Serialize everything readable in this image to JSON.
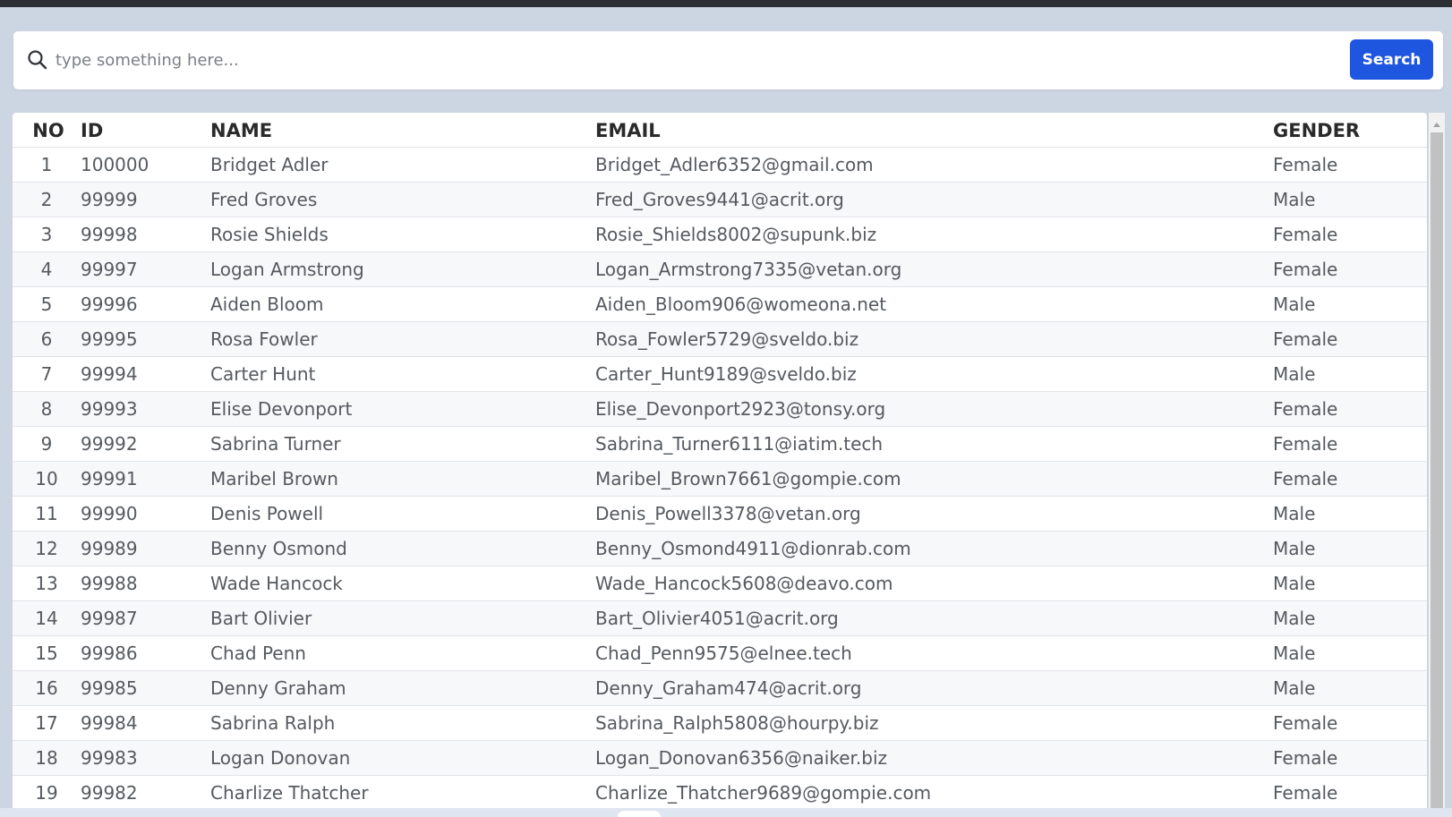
{
  "search": {
    "placeholder": "type something here...",
    "value": "",
    "button_label": "Search",
    "accent_color": "#1f56e0"
  },
  "table": {
    "columns": [
      "NO",
      "ID",
      "NAME",
      "EMAIL",
      "GENDER"
    ],
    "rows": [
      {
        "no": "1",
        "id": "100000",
        "name": "Bridget Adler",
        "email": "Bridget_Adler6352@gmail.com",
        "gender": "Female"
      },
      {
        "no": "2",
        "id": "99999",
        "name": "Fred Groves",
        "email": "Fred_Groves9441@acrit.org",
        "gender": "Male"
      },
      {
        "no": "3",
        "id": "99998",
        "name": "Rosie Shields",
        "email": "Rosie_Shields8002@supunk.biz",
        "gender": "Female"
      },
      {
        "no": "4",
        "id": "99997",
        "name": "Logan Armstrong",
        "email": "Logan_Armstrong7335@vetan.org",
        "gender": "Female"
      },
      {
        "no": "5",
        "id": "99996",
        "name": "Aiden Bloom",
        "email": "Aiden_Bloom906@womeona.net",
        "gender": "Male"
      },
      {
        "no": "6",
        "id": "99995",
        "name": "Rosa Fowler",
        "email": "Rosa_Fowler5729@sveldo.biz",
        "gender": "Female"
      },
      {
        "no": "7",
        "id": "99994",
        "name": "Carter Hunt",
        "email": "Carter_Hunt9189@sveldo.biz",
        "gender": "Male"
      },
      {
        "no": "8",
        "id": "99993",
        "name": "Elise Devonport",
        "email": "Elise_Devonport2923@tonsy.org",
        "gender": "Female"
      },
      {
        "no": "9",
        "id": "99992",
        "name": "Sabrina Turner",
        "email": "Sabrina_Turner6111@iatim.tech",
        "gender": "Female"
      },
      {
        "no": "10",
        "id": "99991",
        "name": "Maribel Brown",
        "email": "Maribel_Brown7661@gompie.com",
        "gender": "Female"
      },
      {
        "no": "11",
        "id": "99990",
        "name": "Denis Powell",
        "email": "Denis_Powell3378@vetan.org",
        "gender": "Male"
      },
      {
        "no": "12",
        "id": "99989",
        "name": "Benny Osmond",
        "email": "Benny_Osmond4911@dionrab.com",
        "gender": "Male"
      },
      {
        "no": "13",
        "id": "99988",
        "name": "Wade Hancock",
        "email": "Wade_Hancock5608@deavo.com",
        "gender": "Male"
      },
      {
        "no": "14",
        "id": "99987",
        "name": "Bart Olivier",
        "email": "Bart_Olivier4051@acrit.org",
        "gender": "Male"
      },
      {
        "no": "15",
        "id": "99986",
        "name": "Chad Penn",
        "email": "Chad_Penn9575@elnee.tech",
        "gender": "Male"
      },
      {
        "no": "16",
        "id": "99985",
        "name": "Denny Graham",
        "email": "Denny_Graham474@acrit.org",
        "gender": "Male"
      },
      {
        "no": "17",
        "id": "99984",
        "name": "Sabrina Ralph",
        "email": "Sabrina_Ralph5808@hourpy.biz",
        "gender": "Female"
      },
      {
        "no": "18",
        "id": "99983",
        "name": "Logan Donovan",
        "email": "Logan_Donovan6356@naiker.biz",
        "gender": "Female"
      },
      {
        "no": "19",
        "id": "99982",
        "name": "Charlize Thatcher",
        "email": "Charlize_Thatcher9689@gompie.com",
        "gender": "Female"
      }
    ]
  },
  "icons": {
    "search": "search-icon",
    "scroll_up": "chevron-up-icon"
  }
}
